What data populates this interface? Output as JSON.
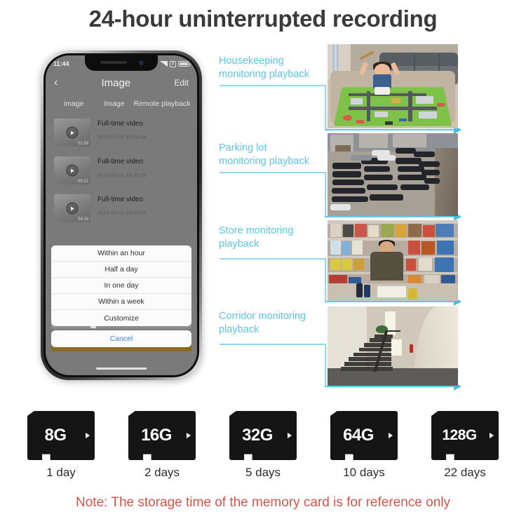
{
  "page": {
    "title": "24-hour uninterrupted recording",
    "note": "Note: The storage time of the memory card is for reference only"
  },
  "phone": {
    "status_bar": {
      "time": "11:44",
      "signal_icon": "signal-bars-icon",
      "wifi_icon": "wifi-icon",
      "battery_icon": "battery-icon"
    },
    "nav": {
      "back_icon": "chevron-left-icon",
      "title": "Image",
      "edit": "Edit"
    },
    "tabs": [
      "image",
      "Image",
      "Remote playback"
    ],
    "video_list": [
      {
        "title": "Full-time video",
        "timestamp": "2019-01-01 15:50:08",
        "duration": "01:59"
      },
      {
        "title": "Full-time video",
        "timestamp": "2019-01-01 15:45:08",
        "duration": "05:32"
      },
      {
        "title": "Full-time video",
        "timestamp": "2019-01-01 15:40:08",
        "duration": "04:18"
      }
    ],
    "action_sheet": {
      "options": [
        "Within an hour",
        "Half a day",
        "In one day",
        "Within a week",
        "Customize"
      ],
      "cancel": "Cancel"
    }
  },
  "callouts": [
    {
      "label": "Housekeeping\nmonitoring playback",
      "scene": "living-room-child-playmat"
    },
    {
      "label": "Parking lot\nmonitoring playback",
      "scene": "parking-lot-cars"
    },
    {
      "label": "Store monitoring\nplayback",
      "scene": "convenience-store-owner"
    },
    {
      "label": "Corridor monitoring\nplayback",
      "scene": "stairwell-corridor"
    }
  ],
  "memory_cards": [
    {
      "capacity": "8G",
      "days": "1 day"
    },
    {
      "capacity": "16G",
      "days": "2 days"
    },
    {
      "capacity": "32G",
      "days": "5 days"
    },
    {
      "capacity": "64G",
      "days": "10 days"
    },
    {
      "capacity": "128G",
      "days": "22 days"
    }
  ],
  "colors": {
    "accent_text": "#5cc6e2",
    "accent_line": "#8fd9ea",
    "arrow": "#41c0e0",
    "note": "#d4554b",
    "title": "#3a3a3a"
  }
}
